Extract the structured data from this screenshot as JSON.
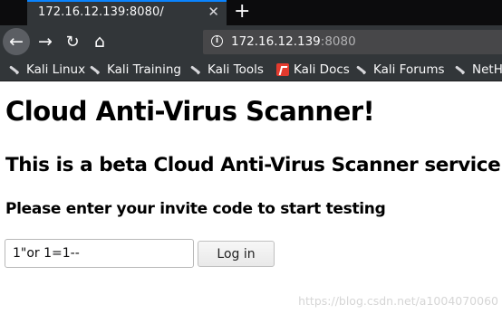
{
  "tab": {
    "title": "172.16.12.139:8080/",
    "close_glyph": "✕",
    "new_tab_glyph": "+"
  },
  "nav": {
    "back_glyph": "←",
    "forward_glyph": "→",
    "reload_glyph": "↻",
    "home_glyph": "⌂"
  },
  "urlbar": {
    "host": "172.16.12.139",
    "port": ":8080",
    "info_glyph": "i"
  },
  "bookmarks": [
    {
      "label": "Kali Linux",
      "icon": "kali-dragon-icon"
    },
    {
      "label": "Kali Training",
      "icon": "kali-dragon-icon"
    },
    {
      "label": "Kali Tools",
      "icon": "kali-dragon-icon"
    },
    {
      "label": "Kali Docs",
      "icon": "kali-docs-icon"
    },
    {
      "label": "Kali Forums",
      "icon": "kali-dragon-icon"
    },
    {
      "label": "NetH",
      "icon": "kali-dragon-icon"
    }
  ],
  "page": {
    "heading": "Cloud Anti-Virus Scanner!",
    "subheading": "This is a beta Cloud Anti-Virus Scanner service.",
    "prompt": "Please enter your invite code to start testing",
    "invite_code_value": "1\"or 1=1--",
    "login_label": "Log in"
  },
  "watermark": "https://blog.csdn.net/a1004070060",
  "colors": {
    "tab_accent": "#0a84ff",
    "chrome_dark": "#323639",
    "tabbar_bg": "#0c0c0d"
  }
}
